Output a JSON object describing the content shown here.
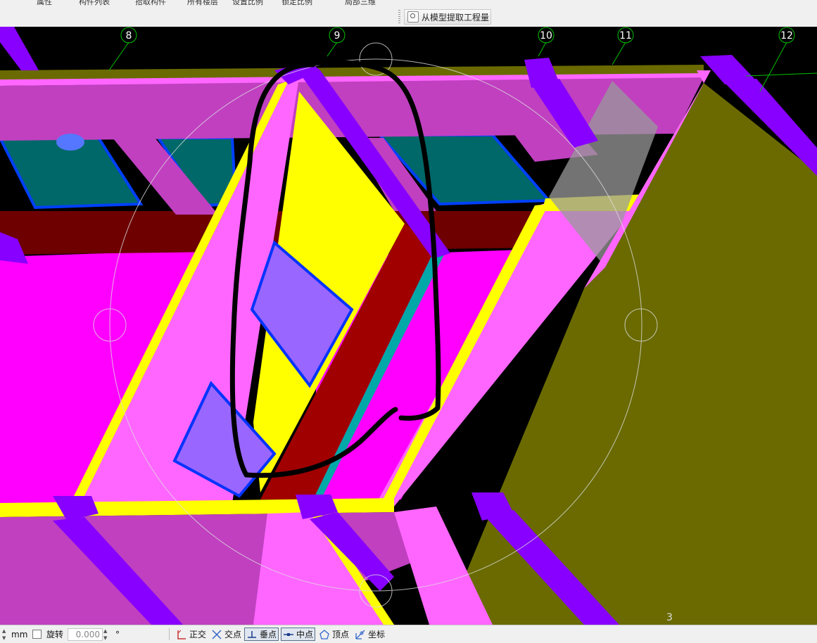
{
  "toolbar": {
    "cut_row_items": [
      "属性",
      "构件列表",
      "拾取构件",
      "所有楼层",
      "设置比例",
      "锁定比例",
      "局部三维"
    ],
    "extract_button_label": "从模型提取工程量"
  },
  "viewport": {
    "axis_labels": [
      "8",
      "9",
      "10",
      "11",
      "12"
    ],
    "edge_label": "3"
  },
  "statusbar": {
    "unit": "mm",
    "rotate_label": "旋转",
    "rotate_value": "0.000",
    "degree_symbol": "°",
    "snaps": [
      {
        "label": "正交",
        "icon": "ortho-icon",
        "active": false
      },
      {
        "label": "交点",
        "icon": "intersection-icon",
        "active": false
      },
      {
        "label": "垂点",
        "icon": "perpendicular-icon",
        "active": true
      },
      {
        "label": "中点",
        "icon": "midpoint-icon",
        "active": true
      },
      {
        "label": "顶点",
        "icon": "vertex-icon",
        "active": false
      },
      {
        "label": "坐标",
        "icon": "coordinate-icon",
        "active": false
      }
    ]
  },
  "colors": {
    "slab_magenta": "#ff00ff",
    "beam_pink": "#ff66ff",
    "beam_side": "#c040c0",
    "column_purple": "#8800ff",
    "wall_olive": "#6a6a00",
    "window_teal": "#006868",
    "yellow_edge": "#ffff00",
    "dark_red": "#6e0000",
    "opening_lavender": "#9966ff",
    "axis_green": "#00c000"
  }
}
